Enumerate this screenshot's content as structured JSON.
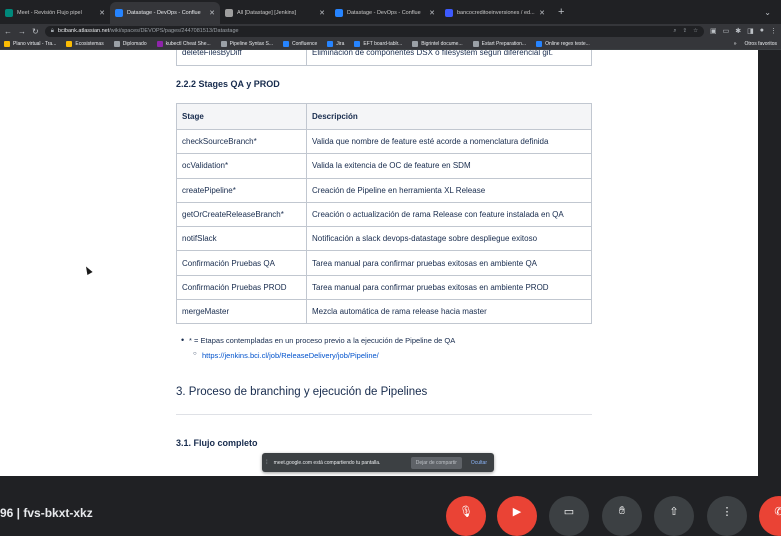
{
  "browser": {
    "tabs": [
      {
        "title": "Meet - Revisión Flujo pipel",
        "active": false,
        "color": "#00897b"
      },
      {
        "title": "Datastage - DevOps - Conflue",
        "active": true,
        "color": "#2684ff"
      },
      {
        "title": "All [Datastage] [Jenkins]",
        "active": false,
        "color": "#9e9e9e"
      },
      {
        "title": "Datastage - DevOps - Conflue",
        "active": false,
        "color": "#2684ff"
      },
      {
        "title": "bancocreditoeinversiones / ed...",
        "active": false,
        "color": "#3d5afe"
      }
    ],
    "new_tab": "+",
    "tab_menu": "⌄",
    "url_host": "bcibank.atlassian.net",
    "url_path": "/wiki/spaces/DEVOPS/pages/2447081513/Datastage",
    "bookmarks": [
      {
        "label": "Plano virtual - Tra...",
        "color": "#fbbc04"
      },
      {
        "label": "Ecosistemas",
        "color": "#fbbc04"
      },
      {
        "label": "Diplomado",
        "color": "#9aa0a6"
      },
      {
        "label": "kubectl Cheat She...",
        "color": "#8e24aa"
      },
      {
        "label": "Pipeline Syntax S...",
        "color": "#9aa0a6"
      },
      {
        "label": "Confluence",
        "color": "#2684ff"
      },
      {
        "label": "Jira",
        "color": "#2684ff"
      },
      {
        "label": "EFT board-tablr...",
        "color": "#2684ff"
      },
      {
        "label": "Bigrintel docume...",
        "color": "#9aa0a6"
      },
      {
        "label": "Estart Preparation...",
        "color": "#9aa0a6"
      },
      {
        "label": "Online regex teste...",
        "color": "#2684ff"
      }
    ],
    "bookmarks_more": "»",
    "bookmarks_other": "Otros favoritos"
  },
  "page": {
    "prev_row": {
      "stage": "deleteFilesByDiff",
      "description": "Eliminación de componentes DSX o filesystem según diferencial git."
    },
    "section_title": "2.2.2 Stages QA y PROD",
    "table": {
      "headers": [
        "Stage",
        "Descripción"
      ],
      "rows": [
        {
          "stage": "checkSourceBranch*",
          "description": "Valida que nombre de feature esté acorde a nomenclatura definida"
        },
        {
          "stage": "ocValidation*",
          "description": "Valida la exitencia de OC de feature en SDM"
        },
        {
          "stage": "createPipeline*",
          "description": "Creación de Pipeline en herramienta XL Release"
        },
        {
          "stage": "getOrCreateReleaseBranch*",
          "description": "Creación o actualización de rama Release con feature instalada en QA"
        },
        {
          "stage": "notifSlack",
          "description": "Notificación a slack devops-datastage sobre despliegue exitoso"
        },
        {
          "stage": "Confirmación Pruebas QA",
          "description": "Tarea manual para confirmar pruebas exitosas en ambiente QA"
        },
        {
          "stage": "Confirmación Pruebas PROD",
          "description": "Tarea manual para confirmar pruebas exitosas en ambiente PROD"
        },
        {
          "stage": "mergeMaster",
          "description": "Mezcla automática de rama release hacia master"
        }
      ]
    },
    "note": "* = Etapas contempladas en un proceso previo a la ejecución de Pipeline de QA",
    "note_link": "https://jenkins.bci.cl/job/ReleaseDelivery/job/Pipeline/",
    "h3": "3. Proceso de branching y ejecución de Pipelines",
    "h31": "3.1. Flujo completo"
  },
  "share_bar": {
    "grip": "⁞",
    "message": "meet.google.com está compartiendo tu pantalla.",
    "stop_label": "Dejar de compartir",
    "hide_label": "Ocultar"
  },
  "meet": {
    "name": "96 | fvs-bkxt-xkz"
  }
}
